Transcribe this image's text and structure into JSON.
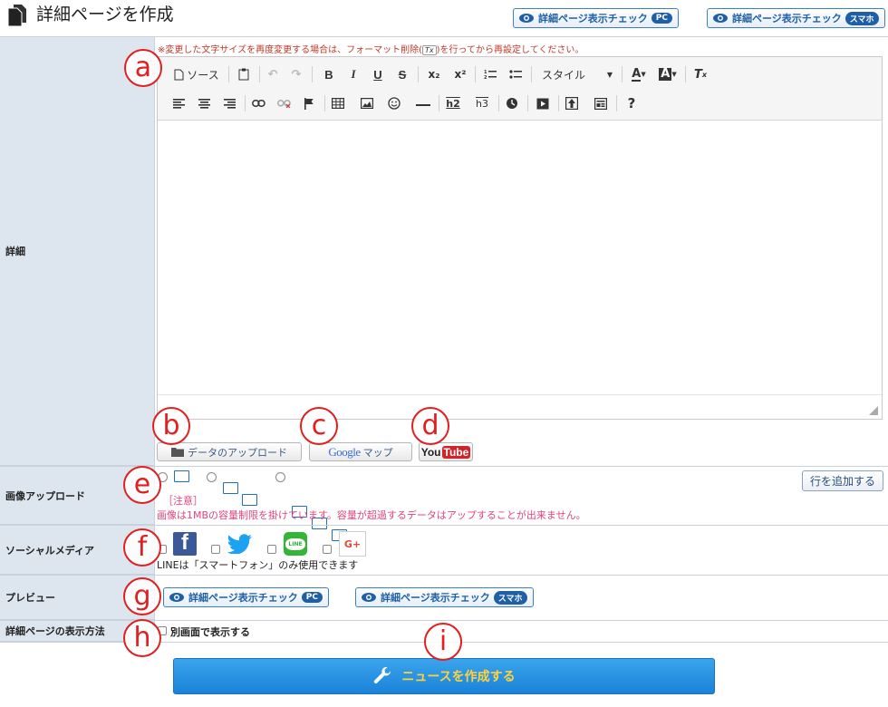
{
  "header": {
    "title": "詳細ページを作成",
    "check_pc": {
      "label": "詳細ページ表示チェック",
      "badge": "PC"
    },
    "check_sp": {
      "label": "詳細ページ表示チェック",
      "badge": "スマホ"
    }
  },
  "detail": {
    "label": "詳細",
    "notice_pre": "※変更した文字サイズを再度変更する場合は、フォーマット削除(",
    "notice_icon": "Tx",
    "notice_post": ")を行ってから再設定してください。",
    "toolbar": {
      "source": "ソース",
      "style": "スタイル",
      "bold": "B",
      "italic": "I",
      "underline": "U",
      "strike": "S",
      "subscript": "x₂",
      "superscript": "x²",
      "h2": "h2",
      "h3": "h3",
      "help": "?"
    },
    "buttons": {
      "upload": "データのアップロード",
      "google_word": "Google",
      "google_map": "マップ",
      "youtube_you": "You",
      "youtube_tube": "Tube"
    }
  },
  "images": {
    "label": "画像アップロード",
    "add_row": "行を追加する",
    "note_title": "［注意］",
    "note_body": "画像は1MBの容量制限を掛けています。容量が超過するデータはアップすることが出来ません。"
  },
  "social": {
    "label": "ソーシャルメディア",
    "facebook": "f",
    "line": "LINE",
    "google": "G+",
    "line_note": "LINEは「スマートフォン」のみ使用できます"
  },
  "preview": {
    "label": "プレビュー",
    "check_pc": {
      "label": "詳細ページ表示チェック",
      "badge": "PC"
    },
    "check_sp": {
      "label": "詳細ページ表示チェック",
      "badge": "スマホ"
    }
  },
  "display": {
    "label": "詳細ページの表示方法",
    "new_window": "別画面で表示する"
  },
  "submit": {
    "label": "ニュースを作成する"
  },
  "annotations": [
    "a",
    "b",
    "c",
    "d",
    "e",
    "f",
    "g",
    "h",
    "i"
  ],
  "colors": {
    "accent": "#1f5fa6",
    "label_bg": "#dde6ee",
    "annotation": "#e02020",
    "submit": "#1a82d8",
    "submit_text": "#ffd23c"
  }
}
